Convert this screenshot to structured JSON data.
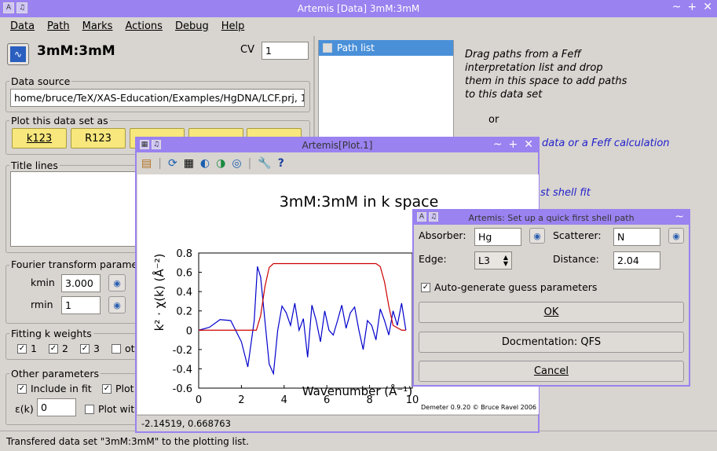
{
  "main_window": {
    "title": "Artemis [Data] 3mM:3mM",
    "menu": [
      "Data",
      "Path",
      "Marks",
      "Actions",
      "Debug",
      "Help"
    ],
    "dataset_name": "3mM:3mM",
    "cv_label": "CV",
    "cv_value": "1",
    "data_source_label": "Data source",
    "data_source_value": "home/bruce/TeX/XAS-Education/Examples/HgDNA/LCF.prj, 1",
    "plot_label": "Plot this data set as",
    "plot_buttons": [
      "k123",
      "R123",
      "",
      "",
      ""
    ],
    "title_lines_label": "Title lines",
    "fourier_label": "Fourier transform parame",
    "kmin_label": "kmin",
    "kmin_value": "3.000",
    "rmin_label": "rmin",
    "rmin_value": "1",
    "fitting_k_label": "Fitting k weights",
    "kweights": [
      "1",
      "2",
      "3",
      "ot"
    ],
    "other_params_label": "Other parameters",
    "include_in_fit": "Include in fit",
    "plot_short": "Plot",
    "epsilon_label": "ε(k)",
    "epsilon_value": "0",
    "plot_with": "Plot wit",
    "path_list_label": "Path list",
    "drag_text": "Drag paths from a Feff interpretation list and drop them in this space to add paths to this data set",
    "or_text": "or",
    "link1": "data or a Feff calculation",
    "link2": "st shell fit",
    "status": "Transfered data set \"3mM:3mM\" to the plotting list."
  },
  "plot_window": {
    "title": "Artemis[Plot.1]",
    "coords": "-2.14519,  0.668763",
    "credit": "Demeter 0.9.20 © Bruce Ravel 2006"
  },
  "dialog": {
    "title": "Artemis: Set up a quick first shell path",
    "absorber_label": "Absorber:",
    "absorber_value": "Hg",
    "scatterer_label": "Scatterer:",
    "scatterer_value": "N",
    "edge_label": "Edge:",
    "edge_value": "L3",
    "distance_label": "Distance:",
    "distance_value": "2.04",
    "auto_generate": "Auto-generate guess parameters",
    "ok": "OK",
    "docs": "Docmentation: QFS",
    "cancel": "Cancel"
  },
  "chart_data": {
    "type": "line",
    "title": "3mM:3mM in k space",
    "xlabel": "Wavenumber   (Å⁻¹)",
    "ylabel": "k² · χ(k)   (Å⁻²)",
    "xlim": [
      0,
      10
    ],
    "ylim": [
      -0.6,
      0.8
    ],
    "xticks": [
      "0",
      "2",
      "4",
      "6",
      "8",
      "10"
    ],
    "yticks": [
      "-0.6",
      "-0.4",
      "-0.2",
      "0",
      "0.2",
      "0.4",
      "0.6",
      "0.8"
    ],
    "series": [
      {
        "color": "#0000cc",
        "x": [
          0,
          0.5,
          1.0,
          1.5,
          2.0,
          2.3,
          2.6,
          2.75,
          2.9,
          3.1,
          3.3,
          3.5,
          3.7,
          3.9,
          4.1,
          4.3,
          4.5,
          4.7,
          4.9,
          5.1,
          5.3,
          5.5,
          5.7,
          5.9,
          6.1,
          6.3,
          6.5,
          6.7,
          6.9,
          7.1,
          7.3,
          7.5,
          7.7,
          7.9,
          8.1,
          8.3,
          8.5,
          8.7,
          8.9,
          9.1,
          9.3,
          9.5,
          9.7
        ],
        "y": [
          0.0,
          0.03,
          0.11,
          0.1,
          -0.12,
          -0.38,
          0.1,
          0.66,
          0.55,
          0.1,
          -0.35,
          -0.45,
          0.0,
          0.25,
          0.18,
          0.05,
          0.28,
          0.0,
          0.12,
          -0.28,
          0.26,
          0.1,
          -0.12,
          0.2,
          0.0,
          -0.05,
          0.1,
          0.26,
          0.02,
          0.18,
          0.24,
          0.0,
          -0.2,
          0.1,
          0.05,
          -0.1,
          0.22,
          0.1,
          -0.05,
          0.2,
          0.05,
          0.28,
          0.0
        ]
      },
      {
        "color": "#cc0000",
        "x": [
          0,
          2.5,
          2.7,
          2.9,
          3.1,
          3.3,
          3.5,
          8.3,
          8.5,
          8.7,
          8.9,
          9.1,
          9.5,
          9.7
        ],
        "y": [
          0,
          0,
          0.0,
          0.15,
          0.45,
          0.65,
          0.69,
          0.69,
          0.66,
          0.5,
          0.25,
          0.05,
          0,
          0
        ]
      }
    ]
  }
}
